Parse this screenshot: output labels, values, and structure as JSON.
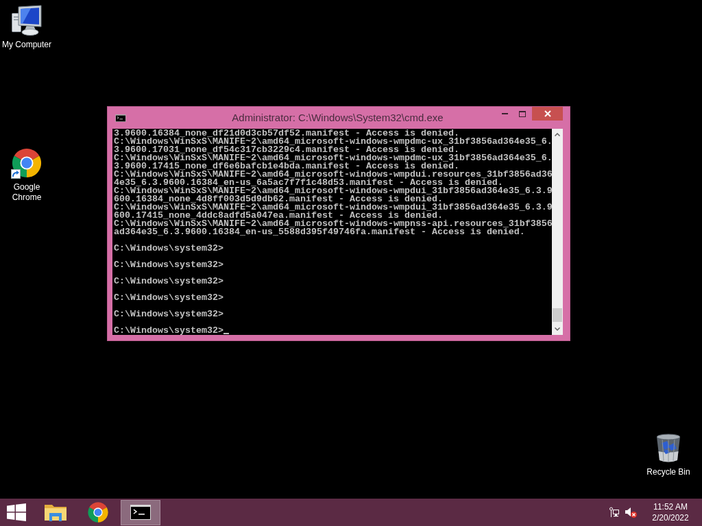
{
  "desktop_icons": [
    {
      "label": "My Computer",
      "kind": "computer",
      "shortcut": false
    },
    {
      "label": "Google Chrome",
      "kind": "chrome",
      "shortcut": true
    },
    {
      "label": "Recycle Bin",
      "kind": "recycle_bin",
      "shortcut": false
    }
  ],
  "window": {
    "title": "Administrator: C:\\Windows\\System32\\cmd.exe",
    "console": {
      "output": [
        "3.9600.16384_none_df21d0d3cb57df52.manifest - Access is denied.",
        "C:\\Windows\\WinSxS\\MANIFE~2\\amd64_microsoft-windows-wmpdmc-ux_31bf3856ad364e35_6.",
        "3.9600.17031_none_df54c317cb3229c4.manifest - Access is denied.",
        "C:\\Windows\\WinSxS\\MANIFE~2\\amd64_microsoft-windows-wmpdmc-ux_31bf3856ad364e35_6.",
        "3.9600.17415_none_df6e6bafcb1e4bda.manifest - Access is denied.",
        "C:\\Windows\\WinSxS\\MANIFE~2\\amd64_microsoft-windows-wmpdui.resources_31bf3856ad36",
        "4e35_6.3.9600.16384_en-us_6a5ac7f7f1c48d53.manifest - Access is denied.",
        "C:\\Windows\\WinSxS\\MANIFE~2\\amd64_microsoft-windows-wmpdui_31bf3856ad364e35_6.3.9",
        "600.16384_none_4d8ff003d5d9db62.manifest - Access is denied.",
        "C:\\Windows\\WinSxS\\MANIFE~2\\amd64_microsoft-windows-wmpdui_31bf3856ad364e35_6.3.9",
        "600.17415_none_4ddc8adfd5a047ea.manifest - Access is denied.",
        "C:\\Windows\\WinSxS\\MANIFE~2\\amd64_microsoft-windows-wmpnss-api.resources_31bf3856",
        "ad364e35_6.3.9600.16384_en-us_5588d395f49746fa.manifest - Access is denied."
      ],
      "prompts": [
        {
          "text": "C:\\Windows\\system32>",
          "cursor": false
        },
        {
          "text": "C:\\Windows\\system32>",
          "cursor": false
        },
        {
          "text": "C:\\Windows\\system32>",
          "cursor": false
        },
        {
          "text": "C:\\Windows\\system32>",
          "cursor": false
        },
        {
          "text": "C:\\Windows\\system32>",
          "cursor": false
        },
        {
          "text": "C:\\Windows\\system32>",
          "cursor": true
        }
      ]
    }
  },
  "taskbar": {
    "buttons": [
      {
        "kind": "explorer",
        "selected": false
      },
      {
        "kind": "chrome",
        "selected": false
      },
      {
        "kind": "console",
        "selected": true
      }
    ],
    "volume_muted": true,
    "time": "11:52 AM",
    "date": "2/20/2022"
  }
}
